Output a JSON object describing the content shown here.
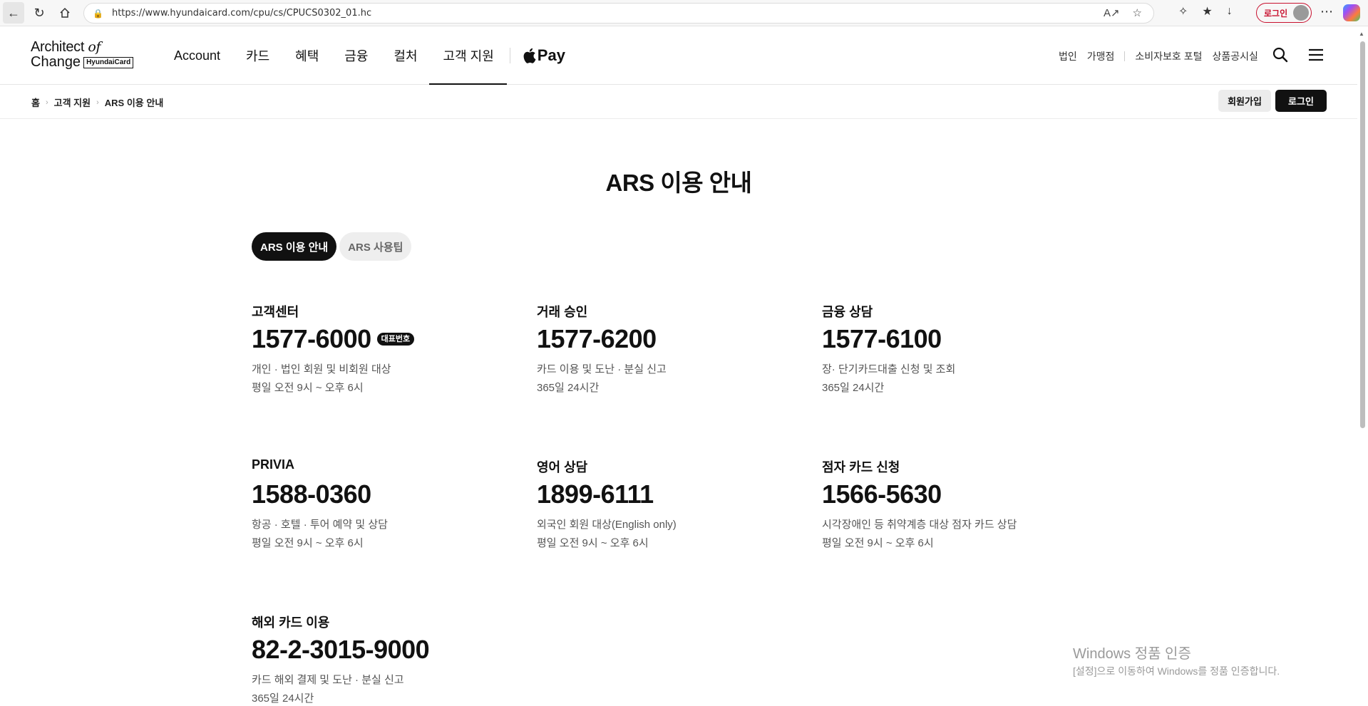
{
  "browser": {
    "url": "https://www.hyundaicard.com/cpu/cs/CPUCS0302_01.hc",
    "profile_label": "로그인"
  },
  "header": {
    "logo": {
      "line1": "Architect ",
      "line1_italic": "of",
      "line2": "Change",
      "box": "HyundaiCard"
    },
    "nav": [
      "Account",
      "카드",
      "혜택",
      "금융",
      "컬처",
      "고객 지원"
    ],
    "apple_pay": "Pay",
    "util_links": [
      "법인",
      "가맹점",
      "소비자보호 포털",
      "상품공시실"
    ]
  },
  "breadcrumb": {
    "items": [
      "홈",
      "고객 지원",
      "ARS 이용 안내"
    ],
    "join_label": "회원가입",
    "login_label": "로그인"
  },
  "main": {
    "title": "ARS 이용 안내",
    "tabs": [
      "ARS 이용 안내",
      "ARS 사용팁"
    ],
    "badge": "대표번호",
    "cards": [
      {
        "title": "고객센터",
        "number": "1577-6000",
        "desc1": "개인 · 법인 회원 및 비회원 대상",
        "desc2": "평일 오전 9시 ~ 오후 6시"
      },
      {
        "title": "거래 승인",
        "number": "1577-6200",
        "desc1": "카드 이용 및 도난 · 분실 신고",
        "desc2": "365일 24시간"
      },
      {
        "title": "금융 상담",
        "number": "1577-6100",
        "desc1": "장· 단기카드대출 신청 및 조회",
        "desc2": "365일 24시간"
      },
      {
        "title": "PRIVIA",
        "number": "1588-0360",
        "desc1": "항공 · 호텔 · 투어 예약 및 상담",
        "desc2": "평일 오전 9시 ~ 오후 6시"
      },
      {
        "title": "영어 상담",
        "number": "1899-6111",
        "desc1": "외국인 회원 대상(English only)",
        "desc2": "평일 오전 9시 ~ 오후 6시"
      },
      {
        "title": "점자 카드 신청",
        "number": "1566-5630",
        "desc1": "시각장애인 등 취약계층 대상 점자 카드 상담",
        "desc2": "평일 오전 9시 ~ 오후 6시"
      },
      {
        "title": "해외 카드 이용",
        "number": "82-2-3015-9000",
        "desc1": "카드 해외 결제 및 도난 · 분실 신고",
        "desc2": "365일 24시간"
      }
    ]
  },
  "watermark": {
    "title": "Windows 정품 인증",
    "subtitle": "[설정]으로 이동하여 Windows를 정품 인증합니다."
  }
}
